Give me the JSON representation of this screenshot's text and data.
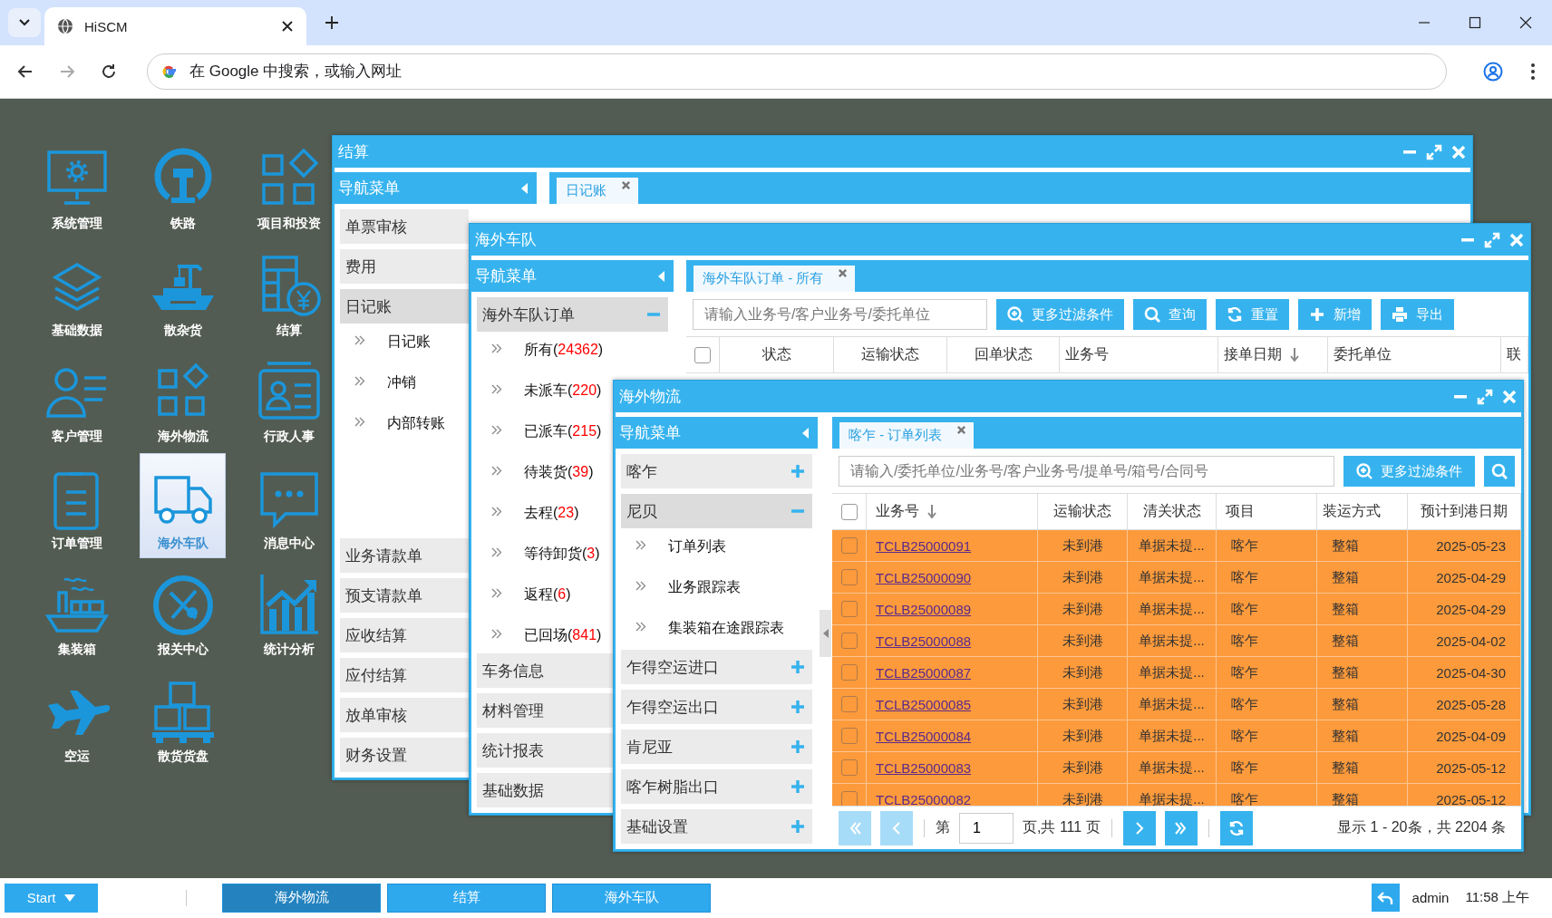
{
  "browser": {
    "tab": {
      "title": "HiSCM",
      "selected": true
    },
    "nav_buttons": [
      {
        "kind": "back",
        "disabled": false
      },
      {
        "kind": "forward",
        "disabled": true
      },
      {
        "kind": "reload",
        "disabled": false
      }
    ],
    "omnibox": {
      "placeholder": "在 Google 中搜索，或输入网址"
    }
  },
  "desktop_icons": [
    {
      "label": "系统管理",
      "selected": false
    },
    {
      "label": "铁路",
      "selected": false
    },
    {
      "label": "项目和投资",
      "selected": false
    },
    {
      "label": "基础数据",
      "selected": false
    },
    {
      "label": "散杂货",
      "selected": false
    },
    {
      "label": "结算",
      "selected": false
    },
    {
      "label": "客户管理",
      "selected": false
    },
    {
      "label": "海外物流",
      "selected": false
    },
    {
      "label": "行政人事",
      "selected": false
    },
    {
      "label": "订单管理",
      "selected": false
    },
    {
      "label": "海外车队",
      "selected": true
    },
    {
      "label": "消息中心",
      "selected": false
    },
    {
      "label": "集装箱",
      "selected": false
    },
    {
      "label": "报关中心",
      "selected": false
    },
    {
      "label": "统计分析",
      "selected": false
    },
    {
      "label": "空运",
      "selected": false
    },
    {
      "label": "散货货盘",
      "selected": false
    }
  ],
  "windows": [
    {
      "title": "结算",
      "nav": {
        "header": "导航菜单",
        "groups": [
          {
            "label": "单票审核",
            "expanded": false
          },
          {
            "label": "费用",
            "expanded": false
          },
          {
            "label": "日记账",
            "expanded": true,
            "children": [
              {
                "label": "日记账"
              },
              {
                "label": "冲销"
              },
              {
                "label": "内部转账"
              }
            ]
          },
          {
            "label": "业务请款单",
            "expanded": false
          },
          {
            "label": "预支请款单",
            "expanded": false
          },
          {
            "label": "应收结算",
            "expanded": false
          },
          {
            "label": "应付结算",
            "expanded": false
          },
          {
            "label": "放单审核",
            "expanded": false
          },
          {
            "label": "财务设置",
            "expanded": false
          }
        ]
      },
      "tabs": [
        {
          "label": "日记账",
          "selected": true
        }
      ]
    },
    {
      "title": "海外车队",
      "nav": {
        "header": "导航菜单",
        "groups": [
          {
            "label": "海外车队订单",
            "expanded": true,
            "toggle_icon": true,
            "children": [
              {
                "label": "所有(",
                "count": "24362",
                "suffix": ")"
              },
              {
                "label": "未派车(",
                "count": "220",
                "suffix": ")"
              },
              {
                "label": "已派车(",
                "count": "215",
                "suffix": ")"
              },
              {
                "label": "待装货(",
                "count": "39",
                "suffix": ")"
              },
              {
                "label": "去程(",
                "count": "23",
                "suffix": ")"
              },
              {
                "label": "等待卸货(",
                "count": "3",
                "suffix": ")"
              },
              {
                "label": "返程(",
                "count": "6",
                "suffix": ")"
              },
              {
                "label": "已回场(",
                "count": "841",
                "suffix": ")"
              }
            ]
          },
          {
            "label": "车务信息",
            "expanded": false
          },
          {
            "label": "材料管理",
            "expanded": false
          },
          {
            "label": "统计报表",
            "expanded": false
          },
          {
            "label": "基础数据",
            "expanded": false
          }
        ]
      },
      "tabs": [
        {
          "label": "海外车队订单 - 所有",
          "selected": true
        }
      ],
      "toolbar": {
        "placeholder": "请输入业务号/客户业务号/委托单位",
        "buttons": [
          {
            "kind": "filter",
            "label": "更多过滤条件"
          },
          {
            "kind": "search",
            "label": "查询"
          },
          {
            "kind": "reset",
            "label": "重置"
          },
          {
            "kind": "add",
            "label": "新增"
          },
          {
            "kind": "export",
            "label": "导出"
          }
        ]
      },
      "table": {
        "select_all": {
          "checked": false
        },
        "columns": [
          {
            "label": "状态"
          },
          {
            "label": "运输状态"
          },
          {
            "label": "回单状态"
          },
          {
            "label": "业务号"
          },
          {
            "label": "接单日期",
            "sorted": true
          },
          {
            "label": "委托单位"
          },
          {
            "label": "联"
          }
        ]
      }
    },
    {
      "title": "海外物流",
      "nav": {
        "header": "导航菜单",
        "groups": [
          {
            "label": "喀乍",
            "expanded": false,
            "toggle_icon": true
          },
          {
            "label": "尼贝",
            "expanded": true,
            "toggle_icon": true,
            "children": [
              {
                "label": "订单列表"
              },
              {
                "label": "业务跟踪表"
              },
              {
                "label": "集装箱在途跟踪表"
              }
            ]
          },
          {
            "label": "乍得空运进口",
            "expanded": false,
            "toggle_icon": true
          },
          {
            "label": "乍得空运出口",
            "expanded": false,
            "toggle_icon": true
          },
          {
            "label": "肯尼亚",
            "expanded": false,
            "toggle_icon": true
          },
          {
            "label": "喀乍树脂出口",
            "expanded": false,
            "toggle_icon": true
          },
          {
            "label": "基础设置",
            "expanded": false,
            "toggle_icon": true
          }
        ]
      },
      "tabs": [
        {
          "label": "喀乍 - 订单列表",
          "selected": true
        }
      ],
      "toolbar": {
        "placeholder": "请输入/委托单位/业务号/客户业务号/提单号/箱号/合同号",
        "buttons": [
          {
            "kind": "filter",
            "label": "更多过滤条件"
          },
          {
            "kind": "search"
          }
        ]
      },
      "table": {
        "select_all": {
          "checked": false
        },
        "columns": [
          {
            "label": "业务号",
            "sorted": true,
            "kind": "link"
          },
          {
            "label": "运输状态"
          },
          {
            "label": "清关状态"
          },
          {
            "label": "项目"
          },
          {
            "label": "装运方式"
          },
          {
            "label": "预计到港日期"
          }
        ],
        "rows": [
          {
            "checked": false,
            "highlighted": true,
            "cells": [
              "TCLB25000091",
              "未到港",
              "单据未提...",
              "喀乍",
              "整箱",
              "2025-05-23"
            ]
          },
          {
            "checked": false,
            "highlighted": true,
            "cells": [
              "TCLB25000090",
              "未到港",
              "单据未提...",
              "喀乍",
              "整箱",
              "2025-04-29"
            ]
          },
          {
            "checked": false,
            "highlighted": true,
            "cells": [
              "TCLB25000089",
              "未到港",
              "单据未提...",
              "喀乍",
              "整箱",
              "2025-04-29"
            ]
          },
          {
            "checked": false,
            "highlighted": true,
            "cells": [
              "TCLB25000088",
              "未到港",
              "单据未提...",
              "喀乍",
              "整箱",
              "2025-04-02"
            ]
          },
          {
            "checked": false,
            "highlighted": true,
            "cells": [
              "TCLB25000087",
              "未到港",
              "单据未提...",
              "喀乍",
              "整箱",
              "2025-04-30"
            ]
          },
          {
            "checked": false,
            "highlighted": true,
            "cells": [
              "TCLB25000085",
              "未到港",
              "单据未提...",
              "喀乍",
              "整箱",
              "2025-05-28"
            ]
          },
          {
            "checked": false,
            "highlighted": true,
            "cells": [
              "TCLB25000084",
              "未到港",
              "单据未提...",
              "喀乍",
              "整箱",
              "2025-04-09"
            ]
          },
          {
            "checked": false,
            "highlighted": true,
            "cells": [
              "TCLB25000083",
              "未到港",
              "单据未提...",
              "喀乍",
              "整箱",
              "2025-05-12"
            ]
          },
          {
            "checked": false,
            "highlighted": true,
            "cells": [
              "TCLB25000082",
              "未到港",
              "单据未提...",
              "喀乍",
              "整箱",
              "2025-05-12"
            ]
          }
        ]
      },
      "pager": {
        "back": [
          {
            "kind": "first",
            "disabled": true
          },
          {
            "kind": "prev",
            "disabled": true
          }
        ],
        "before": "第",
        "page": "1",
        "after": "页,共 111 页",
        "forward": [
          {
            "kind": "next",
            "disabled": false
          },
          {
            "kind": "last",
            "disabled": false
          }
        ],
        "summary": "显示 1 - 20条，共 2204 条"
      }
    }
  ],
  "taskbar": {
    "start": "Start",
    "tasks": [
      {
        "label": "海外物流",
        "selected": true
      },
      {
        "label": "结算",
        "selected": false
      },
      {
        "label": "海外车队",
        "selected": false
      }
    ],
    "user": "admin",
    "time": "11:58 上午"
  }
}
